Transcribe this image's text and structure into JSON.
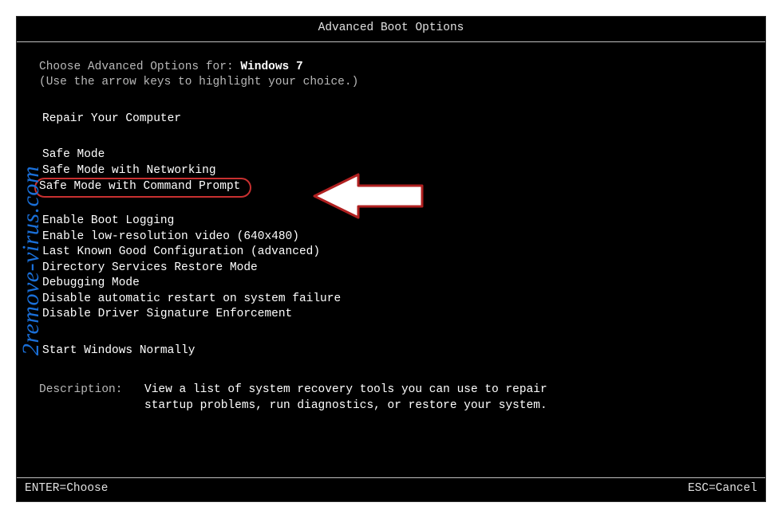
{
  "title": "Advanced Boot Options",
  "intro": {
    "choose_prefix": "Choose Advanced Options for: ",
    "os_name": "Windows 7",
    "hint": "(Use the arrow keys to highlight your choice.)"
  },
  "repair": "Repair Your Computer",
  "menu1": [
    "Safe Mode",
    "Safe Mode with Networking",
    "Safe Mode with Command Prompt"
  ],
  "menu2": [
    "Enable Boot Logging",
    "Enable low-resolution video (640x480)",
    "Last Known Good Configuration (advanced)",
    "Directory Services Restore Mode",
    "Debugging Mode",
    "Disable automatic restart on system failure",
    "Disable Driver Signature Enforcement"
  ],
  "menu3": [
    "Start Windows Normally"
  ],
  "highlighted_index": 2,
  "description": {
    "label": "Description:",
    "text": "View a list of system recovery tools you can use to repair startup problems, run diagnostics, or restore your system."
  },
  "footer": {
    "enter": "ENTER=Choose",
    "esc": "ESC=Cancel"
  },
  "watermark": "2remove-virus.com"
}
